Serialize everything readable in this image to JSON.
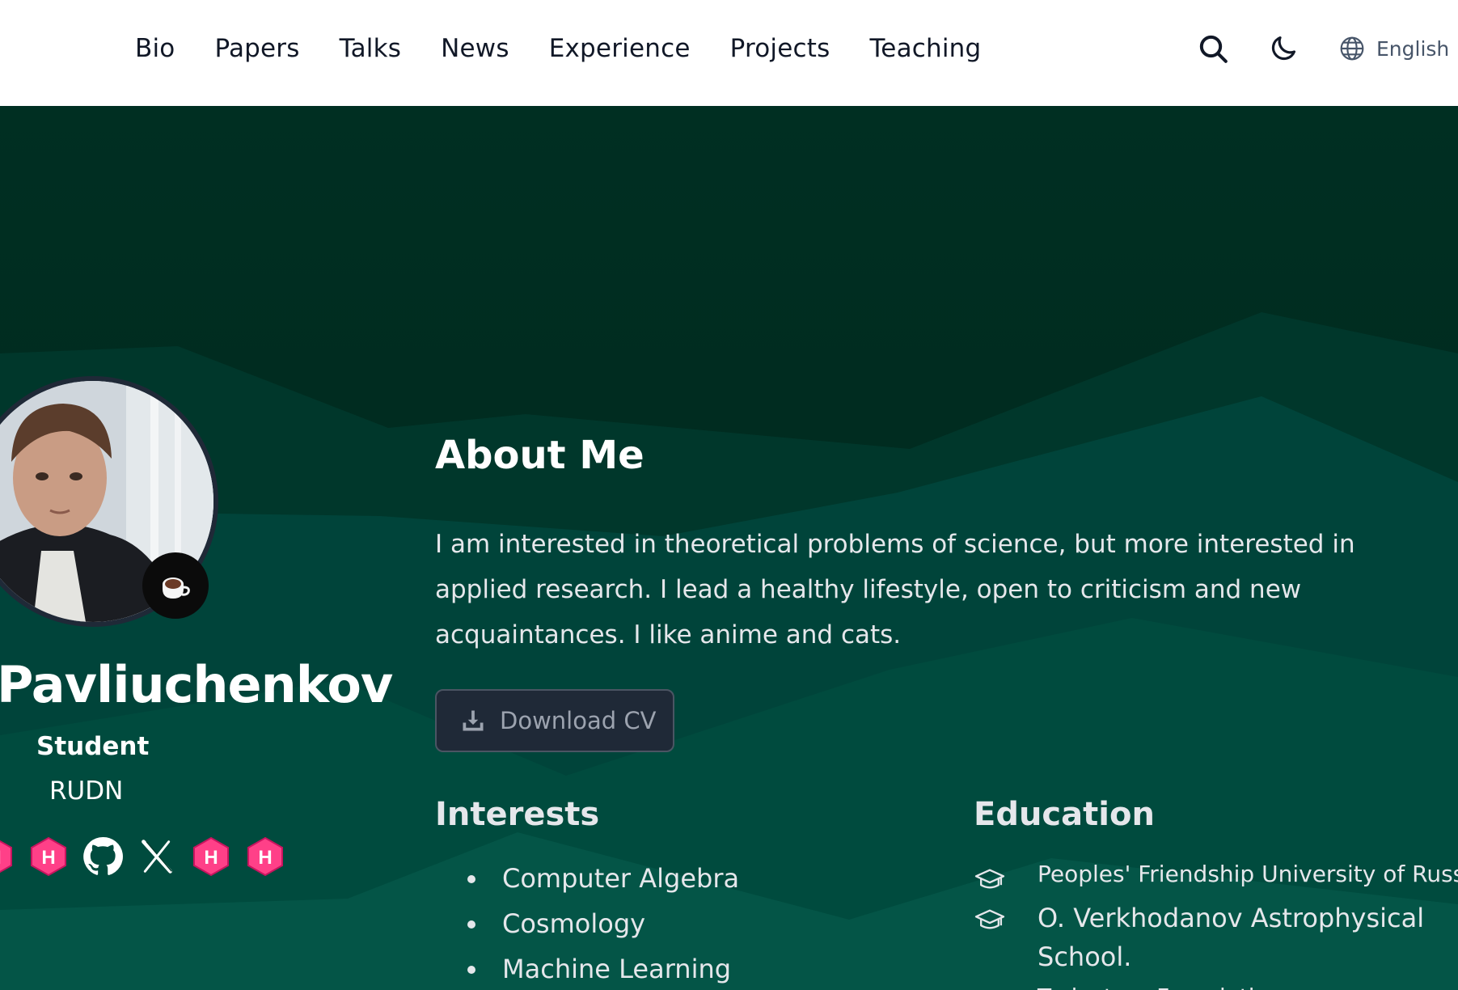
{
  "nav": {
    "items": [
      {
        "label": "Bio"
      },
      {
        "label": "Papers"
      },
      {
        "label": "Talks"
      },
      {
        "label": "News"
      },
      {
        "label": "Experience"
      },
      {
        "label": "Projects"
      },
      {
        "label": "Teaching"
      }
    ],
    "search_icon": "search-icon",
    "theme_icon": "moon-icon",
    "language_label": "English"
  },
  "profile": {
    "name": "Pavliuchenkov",
    "role": "Student",
    "organization": "RUDN",
    "status_icon": "coffee-icon",
    "socials": [
      "hugo-icon",
      "hugo-icon",
      "github-icon",
      "x-icon",
      "hugo-icon",
      "hugo-icon"
    ]
  },
  "about": {
    "title": "About Me",
    "text": "I am interested in theoretical problems of science, but more interested in applied research. I lead a healthy lifestyle, open to criticism and new acquaintances. I like anime and cats.",
    "cv_label": "Download CV"
  },
  "interests": {
    "title": "Interests",
    "items": [
      "Computer Algebra",
      "Cosmology",
      "Machine Learning"
    ]
  },
  "education": {
    "title": "Education",
    "items": [
      {
        "name": "Peoples' Friendship University of Russia"
      },
      {
        "name": "O. Verkhodanov Astrophysical School."
      },
      {
        "name": "Trajectory Foundation"
      }
    ]
  },
  "colors": {
    "hero_dark": "#01261c",
    "hero_mid": "#004a3c",
    "hero_light": "#045547",
    "hugo_pink": "#ff4088"
  }
}
